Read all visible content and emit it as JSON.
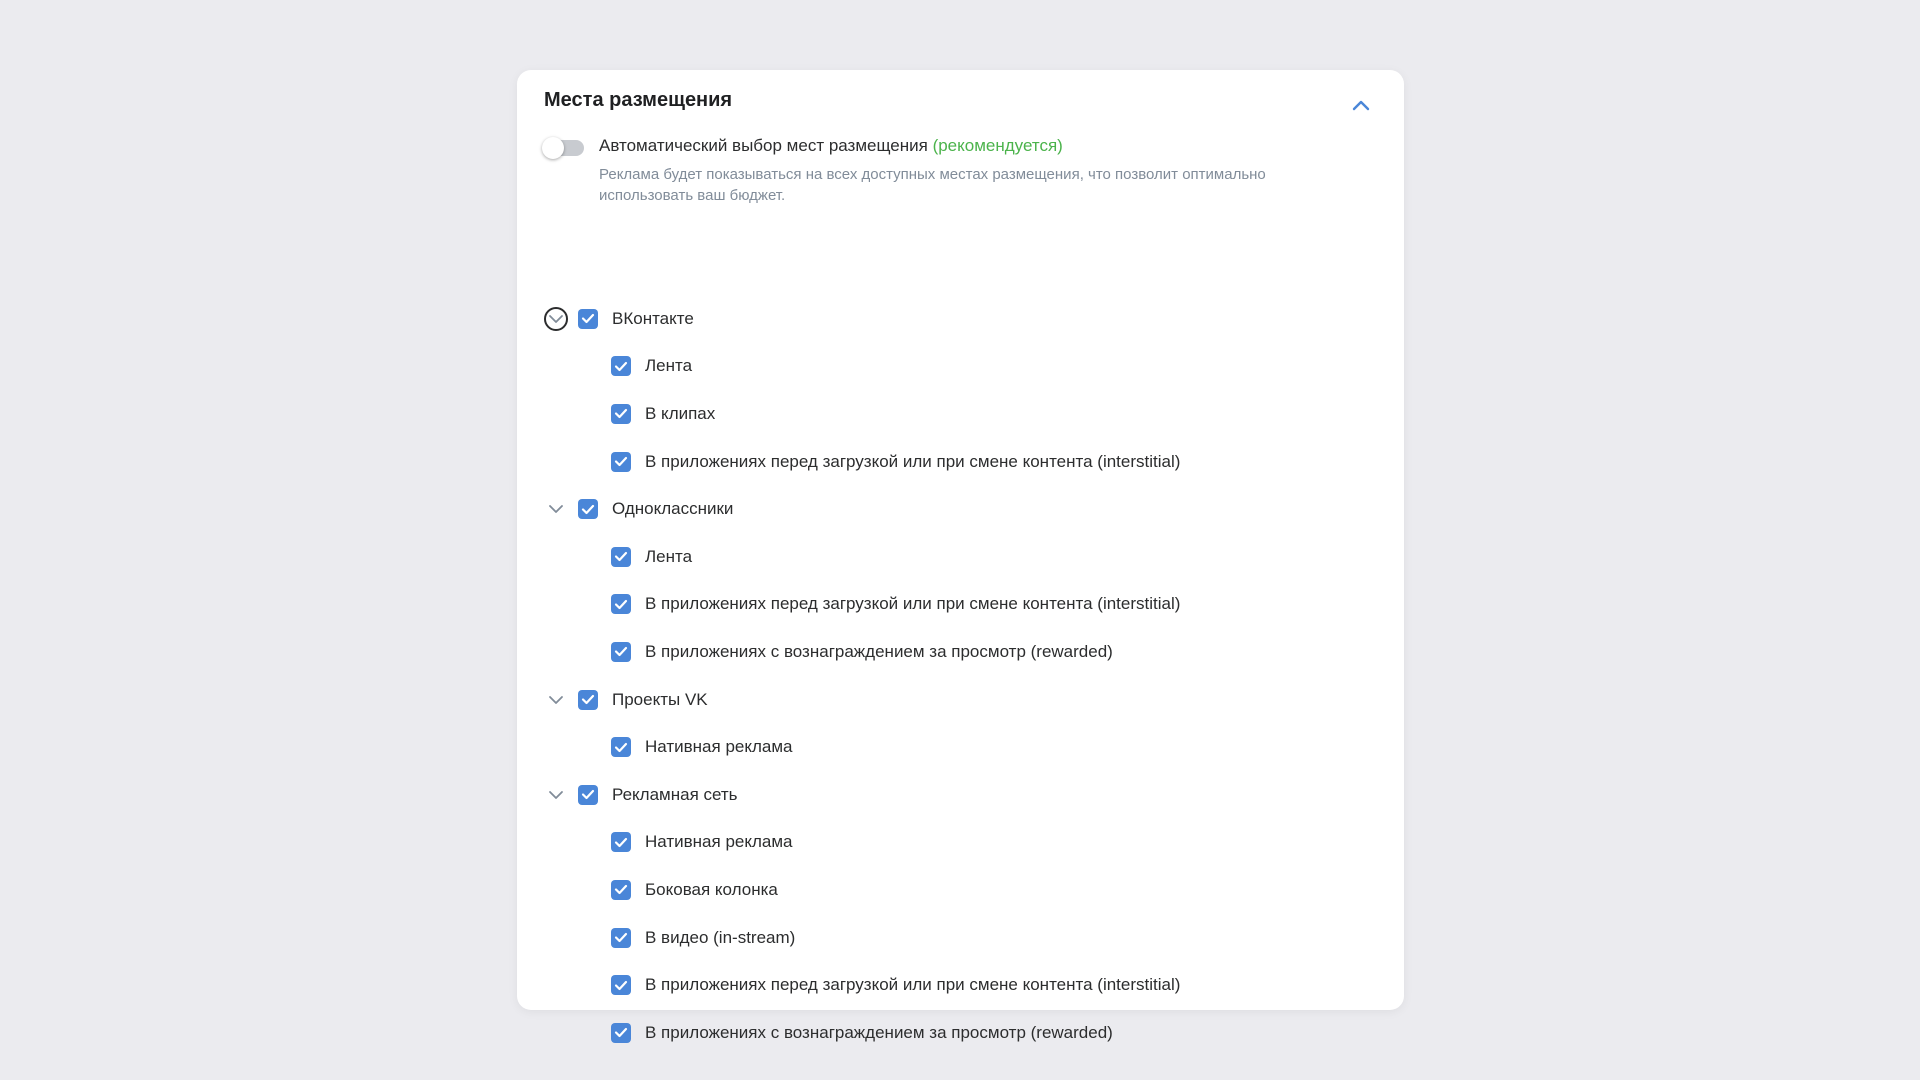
{
  "panel": {
    "title": "Места размещения"
  },
  "auto": {
    "label": "Автоматический выбор мест размещения",
    "recommended": "(рекомендуется)",
    "description": "Реклама будет показываться на всех доступных местах размещения, что позволит оптимально использовать ваш бюджет.",
    "enabled": false
  },
  "colors": {
    "accent": "#4a86d8",
    "recommended": "#4bb34b",
    "secondary_text": "#818c99"
  },
  "groups": [
    {
      "label": "ВКонтакте",
      "checked": true,
      "items": [
        {
          "label": "Лента",
          "checked": true
        },
        {
          "label": "В клипах",
          "checked": true
        },
        {
          "label": "В приложениях перед загрузкой или при смене контента (interstitial)",
          "checked": true
        }
      ]
    },
    {
      "label": "Одноклассники",
      "checked": true,
      "items": [
        {
          "label": "Лента",
          "checked": true
        },
        {
          "label": "В приложениях перед загрузкой или при смене контента (interstitial)",
          "checked": true
        },
        {
          "label": "В приложениях с вознаграждением за просмотр (rewarded)",
          "checked": true
        }
      ]
    },
    {
      "label": "Проекты VK",
      "checked": true,
      "items": [
        {
          "label": "Нативная реклама",
          "checked": true
        }
      ]
    },
    {
      "label": "Рекламная сеть",
      "checked": true,
      "items": [
        {
          "label": "Нативная реклама",
          "checked": true
        },
        {
          "label": "Боковая колонка",
          "checked": true
        },
        {
          "label": "В видео (in-stream)",
          "checked": true
        },
        {
          "label": "В приложениях перед загрузкой или при смене контента (interstitial)",
          "checked": true
        },
        {
          "label": "В приложениях с вознаграждением за просмотр (rewarded)",
          "checked": true
        }
      ]
    }
  ]
}
